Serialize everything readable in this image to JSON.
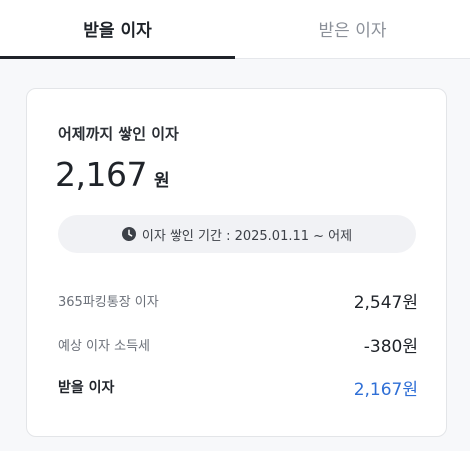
{
  "tabs": [
    {
      "label": "받을 이자",
      "active": true
    },
    {
      "label": "받은 이자",
      "active": false
    }
  ],
  "summary": {
    "title": "어제까지 쌓인 이자",
    "amount": "2,167",
    "unit": "원",
    "period_icon": "clock-icon",
    "period_text": "이자 쌓인 기간 : 2025.01.11 ~ 어제"
  },
  "breakdown": [
    {
      "label": "365파킹통장 이자",
      "value": "2,547원"
    },
    {
      "label": "예상 이자 소득세",
      "value": "-380원"
    },
    {
      "label": "받을 이자",
      "value": "2,167원"
    }
  ],
  "colors": {
    "accent": "#2f6fd6",
    "text": "#1f2329",
    "muted": "#8b9099"
  }
}
